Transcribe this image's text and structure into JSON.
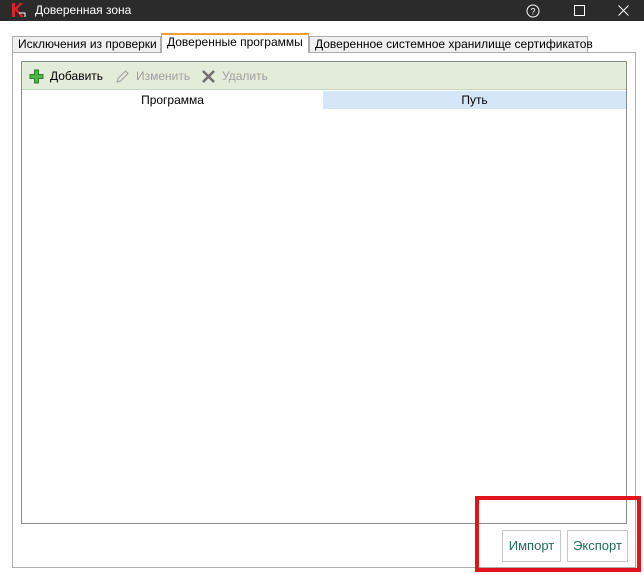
{
  "window": {
    "title": "Доверенная зона",
    "help_icon": "help-circle-icon",
    "maximize_icon": "maximize-icon",
    "close_icon": "close-icon"
  },
  "tabs": [
    {
      "label": "Исключения из проверки",
      "active": false
    },
    {
      "label": "Доверенные программы",
      "active": true
    },
    {
      "label": "Доверенное системное хранилище сертификатов",
      "active": false
    }
  ],
  "toolbar": {
    "add_label": "Добавить",
    "edit_label": "Изменить",
    "delete_label": "Удалить"
  },
  "table": {
    "columns": [
      "Программа",
      "Путь"
    ],
    "rows": []
  },
  "buttons": {
    "import_label": "Импорт",
    "export_label": "Экспорт"
  },
  "colors": {
    "titlebar": "#2b2b2b",
    "toolbar_bg": "#e2ecd8",
    "active_tab_accent": "#f0a030",
    "highlight": "#e0141c",
    "button_text": "#1f6b5a"
  }
}
